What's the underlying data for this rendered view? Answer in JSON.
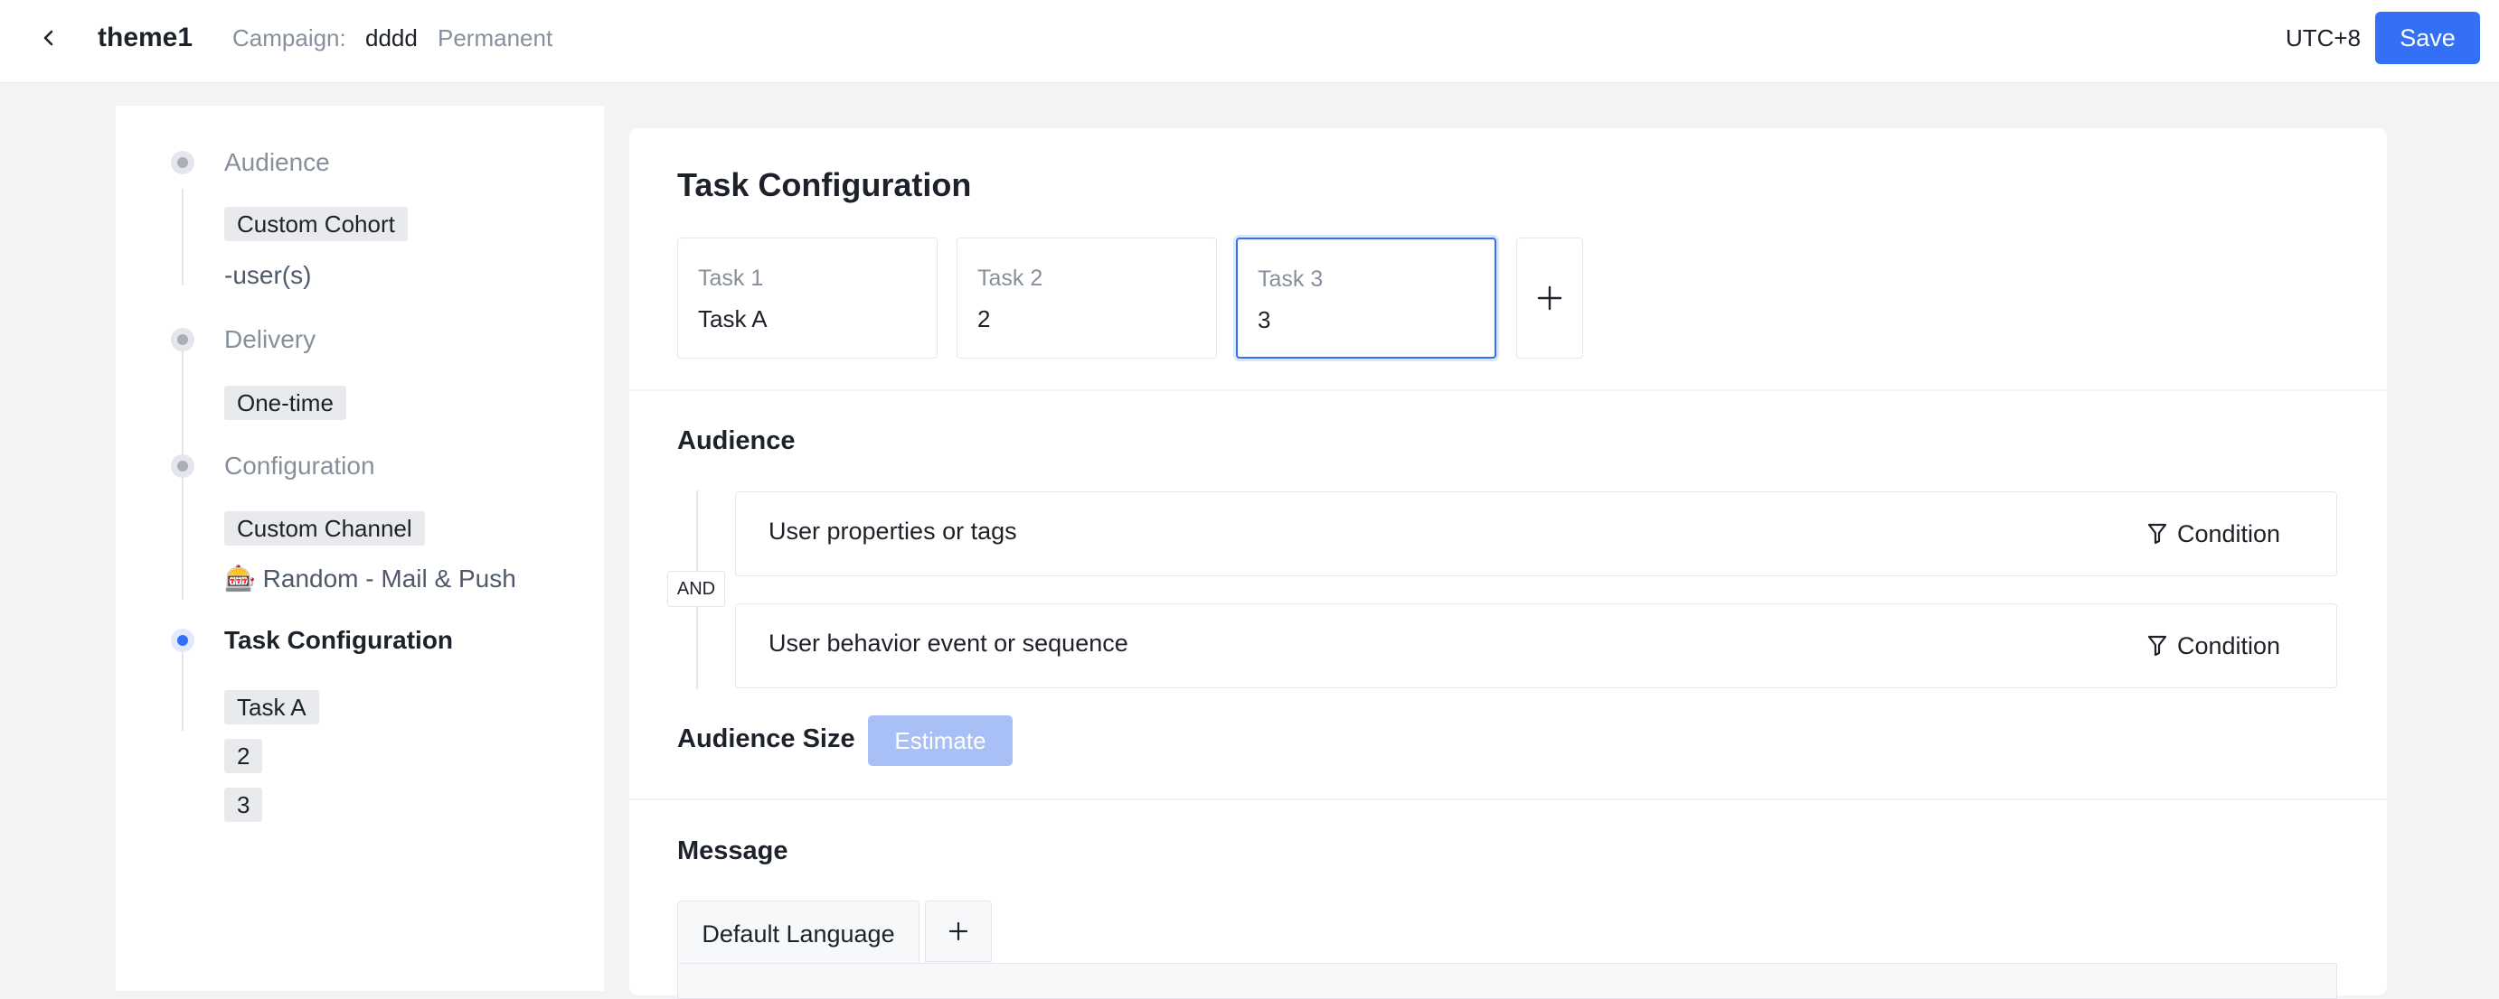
{
  "header": {
    "title": "theme1",
    "campaign_label": "Campaign:",
    "campaign_name": "dddd",
    "campaign_type": "Permanent",
    "timezone": "UTC+8",
    "save_label": "Save"
  },
  "steps": {
    "audience": {
      "title": "Audience",
      "tag": "Custom Cohort",
      "sub": "-user(s)"
    },
    "delivery": {
      "title": "Delivery",
      "tag": "One-time"
    },
    "configuration": {
      "title": "Configuration",
      "tag": "Custom Channel",
      "channel_emoji": "🎰",
      "sub": "Random - Mail & Push"
    },
    "task_configuration": {
      "title": "Task Configuration",
      "tags": [
        "Task A",
        "2",
        "3"
      ]
    }
  },
  "main": {
    "task_config_title": "Task Configuration",
    "tasks": [
      {
        "label": "Task 1",
        "value": "Task A"
      },
      {
        "label": "Task 2",
        "value": "2"
      },
      {
        "label": "Task 3",
        "value": "3"
      }
    ],
    "audience": {
      "title": "Audience",
      "logic": "AND",
      "filters": [
        {
          "label": "User properties or tags",
          "action": "Condition"
        },
        {
          "label": "User behavior event or sequence",
          "action": "Condition"
        }
      ],
      "size_label": "Audience Size",
      "estimate_label": "Estimate"
    },
    "message": {
      "title": "Message",
      "default_tab": "Default Language"
    }
  },
  "colors": {
    "accent": "#3370f5",
    "estimate_disabled": "#a8c0f6"
  }
}
